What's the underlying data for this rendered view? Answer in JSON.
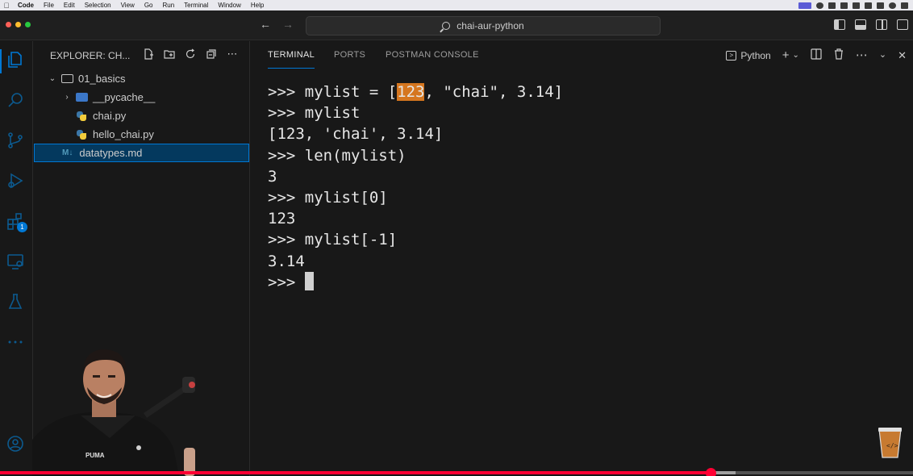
{
  "menubar": {
    "app": "Code",
    "items": [
      "File",
      "Edit",
      "Selection",
      "View",
      "Go",
      "Run",
      "Terminal",
      "Window",
      "Help"
    ]
  },
  "titlebar": {
    "search_text": "chai-aur-python",
    "back_icon": "arrow-left-icon",
    "forward_icon": "arrow-right-icon"
  },
  "activity_bar": {
    "items": [
      "explorer-icon",
      "search-icon",
      "source-control-icon",
      "run-debug-icon",
      "extensions-icon",
      "remote-explorer-icon",
      "testing-icon",
      "more-icon",
      "account-icon"
    ],
    "extensions_badge": "1"
  },
  "sidebar": {
    "title": "EXPLORER: CH...",
    "tree": [
      {
        "label": "01_basics",
        "type": "folder-open"
      },
      {
        "label": "__pycache__",
        "type": "folder"
      },
      {
        "label": "chai.py",
        "type": "python"
      },
      {
        "label": "hello_chai.py",
        "type": "python"
      },
      {
        "label": "datatypes.md",
        "type": "markdown",
        "icon_text": "M↓"
      }
    ]
  },
  "panel": {
    "tabs": [
      "TERMINAL",
      "PORTS",
      "POSTMAN CONSOLE"
    ],
    "active_tab": "TERMINAL",
    "terminal_name": "Python"
  },
  "terminal": {
    "lines": [
      {
        "prefix": ">>> mylist = [",
        "highlight": "123",
        "suffix": ", \"chai\", 3.14]"
      },
      {
        "text": ">>> mylist"
      },
      {
        "text": "[123, 'chai', 3.14]"
      },
      {
        "text": ">>> len(mylist)"
      },
      {
        "text": "3"
      },
      {
        "text": ">>> mylist[0]"
      },
      {
        "text": "123"
      },
      {
        "text": ">>> mylist[-1]"
      },
      {
        "text": "3.14"
      },
      {
        "text": ">>> "
      }
    ]
  },
  "video": {
    "progress": 0.778,
    "buffered": 0.806,
    "accent": "#ff0033"
  },
  "colors": {
    "accent": "#0078d4",
    "highlight": "#d5761f"
  }
}
